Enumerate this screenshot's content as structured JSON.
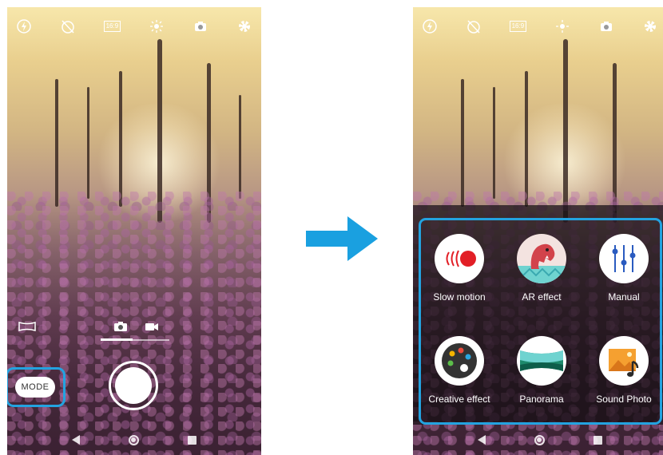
{
  "left_screen": {
    "top_icons": [
      "flash-icon",
      "timer-off-icon",
      "aspect-ratio-icon",
      "brightness-icon",
      "switch-camera-icon",
      "settings-icon"
    ],
    "aspect_ratio_label": "16:9",
    "mode_button_label": "MODE"
  },
  "right_screen": {
    "top_icons": [
      "flash-icon",
      "timer-off-icon",
      "aspect-ratio-icon",
      "brightness-icon",
      "switch-camera-icon",
      "settings-icon"
    ],
    "aspect_ratio_label": "16:9",
    "mode_menu": {
      "items": [
        {
          "label": "Slow motion",
          "icon": "slow-motion-icon"
        },
        {
          "label": "AR effect",
          "icon": "ar-effect-icon"
        },
        {
          "label": "Manual",
          "icon": "manual-icon"
        },
        {
          "label": "Creative effect",
          "icon": "creative-effect-icon"
        },
        {
          "label": "Panorama",
          "icon": "panorama-icon"
        },
        {
          "label": "Sound Photo",
          "icon": "sound-photo-icon"
        }
      ]
    }
  },
  "colors": {
    "highlight": "#23a3e0",
    "arrow": "#1aa0e0",
    "slow_motion_red": "#e21f26"
  }
}
